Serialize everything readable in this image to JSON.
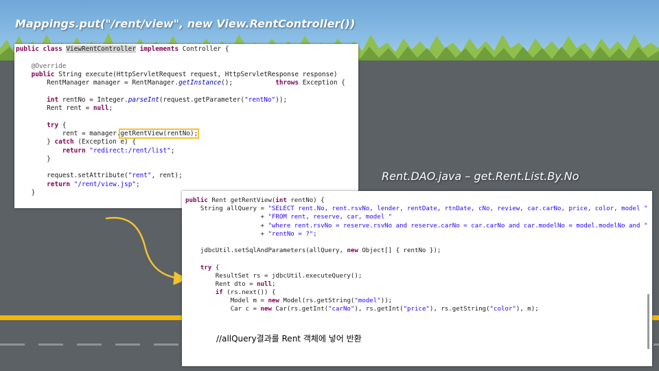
{
  "title": "Mappings.put(\"/rent/view\", new View.RentController())",
  "caption": "Rent.DAO.java – get.Rent.List.By.No",
  "panel1": {
    "lines": [
      [
        {
          "t": "public class ",
          "c": "kw"
        },
        {
          "t": "ViewRentController",
          "c": "hl-bg"
        },
        {
          "t": " "
        },
        {
          "t": "implements",
          "c": "kw"
        },
        {
          "t": " Controller {"
        }
      ],
      [
        {
          "t": ""
        }
      ],
      [
        {
          "t": "    "
        },
        {
          "t": "@Override",
          "c": "ann"
        }
      ],
      [
        {
          "t": "    "
        },
        {
          "t": "public",
          "c": "kw"
        },
        {
          "t": " String execute(HttpServletRequest request, HttpServletResponse response)"
        }
      ],
      [
        {
          "t": "        RentManager manager = RentManager."
        },
        {
          "t": "getInstance",
          "c": "fld"
        },
        {
          "t": "();           "
        },
        {
          "t": "throws",
          "c": "kw"
        },
        {
          "t": " Exception {"
        }
      ],
      [
        {
          "t": ""
        }
      ],
      [
        {
          "t": "        "
        },
        {
          "t": "int",
          "c": "kw"
        },
        {
          "t": " rentNo = Integer."
        },
        {
          "t": "parseInt",
          "c": "fld"
        },
        {
          "t": "(request.getParameter("
        },
        {
          "t": "\"rentNo\"",
          "c": "str"
        },
        {
          "t": "));"
        }
      ],
      [
        {
          "t": "        Rent rent = "
        },
        {
          "t": "null",
          "c": "kw"
        },
        {
          "t": ";"
        }
      ],
      [
        {
          "t": ""
        }
      ],
      [
        {
          "t": "        "
        },
        {
          "t": "try",
          "c": "kw"
        },
        {
          "t": " {"
        }
      ],
      [
        {
          "t": "            rent = manager."
        },
        {
          "t": "getRentView(rentNo);",
          "c": "hl-box"
        }
      ],
      [
        {
          "t": "        } "
        },
        {
          "t": "catch",
          "c": "kw"
        },
        {
          "t": " (Exception e) {"
        }
      ],
      [
        {
          "t": "            "
        },
        {
          "t": "return",
          "c": "kw"
        },
        {
          "t": " "
        },
        {
          "t": "\"redirect:/rent/list\"",
          "c": "str"
        },
        {
          "t": ";"
        }
      ],
      [
        {
          "t": "        }"
        }
      ],
      [
        {
          "t": ""
        }
      ],
      [
        {
          "t": "        request.setAttribute("
        },
        {
          "t": "\"rent\"",
          "c": "str"
        },
        {
          "t": ", rent);"
        }
      ],
      [
        {
          "t": "        "
        },
        {
          "t": "return",
          "c": "kw"
        },
        {
          "t": " "
        },
        {
          "t": "\"/rent/view.jsp\"",
          "c": "str"
        },
        {
          "t": ";"
        }
      ],
      [
        {
          "t": "    }"
        }
      ]
    ]
  },
  "panel2": {
    "lines": [
      [
        {
          "t": "public",
          "c": "kw"
        },
        {
          "t": " Rent getRentView("
        },
        {
          "t": "int",
          "c": "kw"
        },
        {
          "t": " rentNo) {"
        }
      ],
      [
        {
          "t": "    String allQuery = "
        },
        {
          "t": "\"SELECT rent.No, rent.rsvNo, lender, rentDate, rtnDate, cNo, review, car.carNo, price, color, model \"",
          "c": "str"
        }
      ],
      [
        {
          "t": "                    + "
        },
        {
          "t": "\"FROM rent, reserve, car, model \"",
          "c": "str"
        }
      ],
      [
        {
          "t": "                    + "
        },
        {
          "t": "\"where rent.rsvNo = reserve.rsvNo and reserve.carNo = car.carNo and car.modelNo = model.modelNo and \"",
          "c": "str"
        }
      ],
      [
        {
          "t": "                    + "
        },
        {
          "t": "\"rentNo = ?\";",
          "c": "str"
        }
      ],
      [
        {
          "t": ""
        }
      ],
      [
        {
          "t": "    jdbcUtil.setSqlAndParameters(allQuery, "
        },
        {
          "t": "new",
          "c": "kw"
        },
        {
          "t": " Object[] { rentNo });"
        }
      ],
      [
        {
          "t": ""
        }
      ],
      [
        {
          "t": "    "
        },
        {
          "t": "try",
          "c": "kw"
        },
        {
          "t": " {"
        }
      ],
      [
        {
          "t": "        ResultSet rs = jdbcUtil.executeQuery();"
        }
      ],
      [
        {
          "t": "        Rent dto = "
        },
        {
          "t": "null",
          "c": "kw"
        },
        {
          "t": ";"
        }
      ],
      [
        {
          "t": "        "
        },
        {
          "t": "if",
          "c": "kw"
        },
        {
          "t": " (rs.next()) {"
        }
      ],
      [
        {
          "t": "            Model m = "
        },
        {
          "t": "new",
          "c": "kw"
        },
        {
          "t": " Model(rs.getString("
        },
        {
          "t": "\"model\"",
          "c": "str"
        },
        {
          "t": "));"
        }
      ],
      [
        {
          "t": "            Car c = "
        },
        {
          "t": "new",
          "c": "kw"
        },
        {
          "t": " Car(rs.getInt("
        },
        {
          "t": "\"carNo\"",
          "c": "str"
        },
        {
          "t": "), rs.getInt("
        },
        {
          "t": "\"price\"",
          "c": "str"
        },
        {
          "t": "), rs.getString("
        },
        {
          "t": "\"color\"",
          "c": "str"
        },
        {
          "t": "), m);"
        }
      ]
    ],
    "note": "//allQuery결과를 Rent 객체에 넣어 반환"
  },
  "colors": {
    "keyword": "#7f0055",
    "string": "#2a00ff",
    "highlight": "#f2c230",
    "road_line": "#f2b705"
  }
}
